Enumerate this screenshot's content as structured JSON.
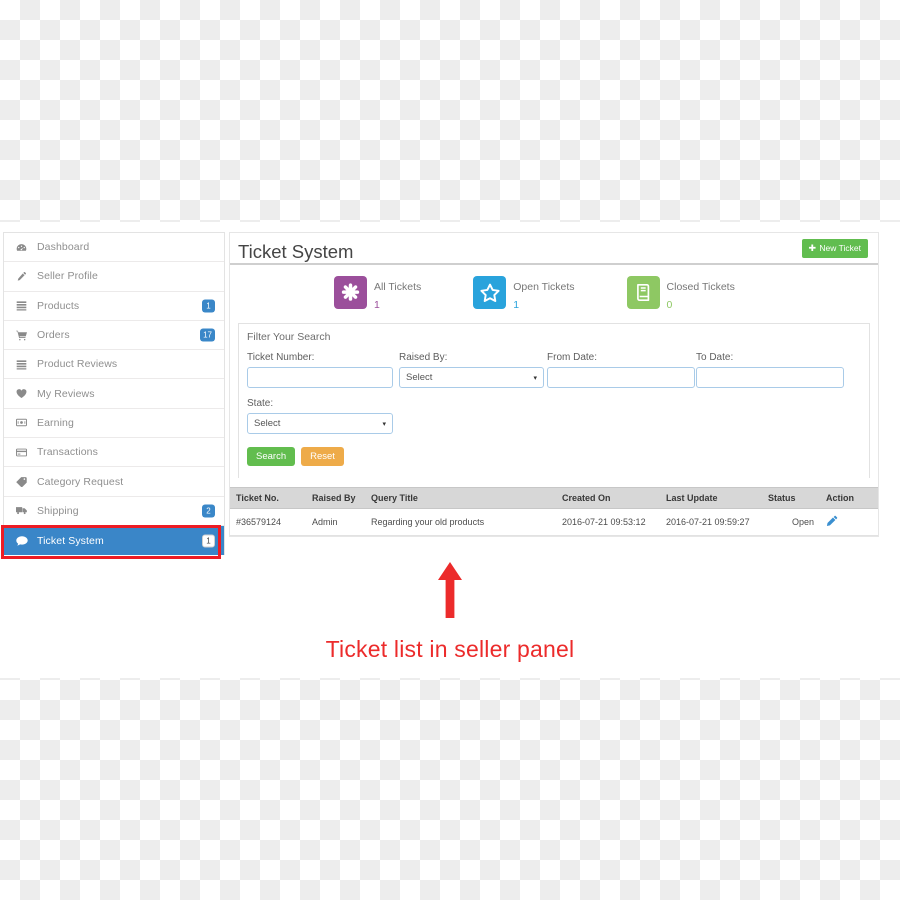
{
  "sidebar": {
    "items": [
      {
        "label": "Dashboard",
        "icon": "dashboard-icon",
        "badge": null,
        "active": false
      },
      {
        "label": "Seller Profile",
        "icon": "pencil-icon",
        "badge": null,
        "active": false
      },
      {
        "label": "Products",
        "icon": "list-icon",
        "badge": "1",
        "active": false
      },
      {
        "label": "Orders",
        "icon": "shopping-cart-icon",
        "badge": "17",
        "active": false
      },
      {
        "label": "Product Reviews",
        "icon": "list-icon",
        "badge": null,
        "active": false
      },
      {
        "label": "My Reviews",
        "icon": "heart-icon",
        "badge": null,
        "active": false
      },
      {
        "label": "Earning",
        "icon": "money-icon",
        "badge": null,
        "active": false
      },
      {
        "label": "Transactions",
        "icon": "credit-card-icon",
        "badge": null,
        "active": false
      },
      {
        "label": "Category Request",
        "icon": "tag-icon",
        "badge": null,
        "active": false
      },
      {
        "label": "Shipping",
        "icon": "truck-icon",
        "badge": "2",
        "active": false
      },
      {
        "label": "Ticket System",
        "icon": "comment-icon",
        "badge": "1",
        "active": true
      }
    ]
  },
  "header": {
    "title": "Ticket System",
    "new_ticket_label": "New Ticket",
    "new_ticket_plus": "✚"
  },
  "stats": [
    {
      "label": "All Tickets",
      "value": "1",
      "icon": "asterisk-icon",
      "color": "#9b4f9b"
    },
    {
      "label": "Open Tickets",
      "value": "1",
      "icon": "star-icon",
      "color": "#29a3dc"
    },
    {
      "label": "Closed Tickets",
      "value": "0",
      "icon": "book-icon",
      "color": "#8ec863"
    }
  ],
  "filter": {
    "title": "Filter Your Search",
    "ticket_number_label": "Ticket Number:",
    "ticket_number_value": "",
    "ticket_number_placeholder": "",
    "raised_by_label": "Raised By:",
    "raised_by_value": "Select",
    "from_date_label": "From Date:",
    "from_date_value": "",
    "from_date_placeholder": "",
    "to_date_label": "To Date:",
    "to_date_value": "",
    "to_date_placeholder": "",
    "state_label": "State:",
    "state_value": "Select",
    "caret": "▾",
    "search_label": "Search",
    "reset_label": "Reset"
  },
  "table": {
    "columns": [
      "Ticket No.",
      "Raised By",
      "Query Title",
      "Created On",
      "Last Update",
      "Status",
      "Action"
    ],
    "rows": [
      {
        "ticket_no": "#36579124",
        "raised_by": "Admin",
        "query_title": "Regarding your old products",
        "created_on": "2016-07-21 09:53:12",
        "last_update": "2016-07-21 09:59:27",
        "status": "Open",
        "action_icon": "edit-pencil-icon"
      }
    ]
  },
  "annotation": {
    "caption": "Ticket list in seller panel",
    "color": "#ec2b2b"
  }
}
